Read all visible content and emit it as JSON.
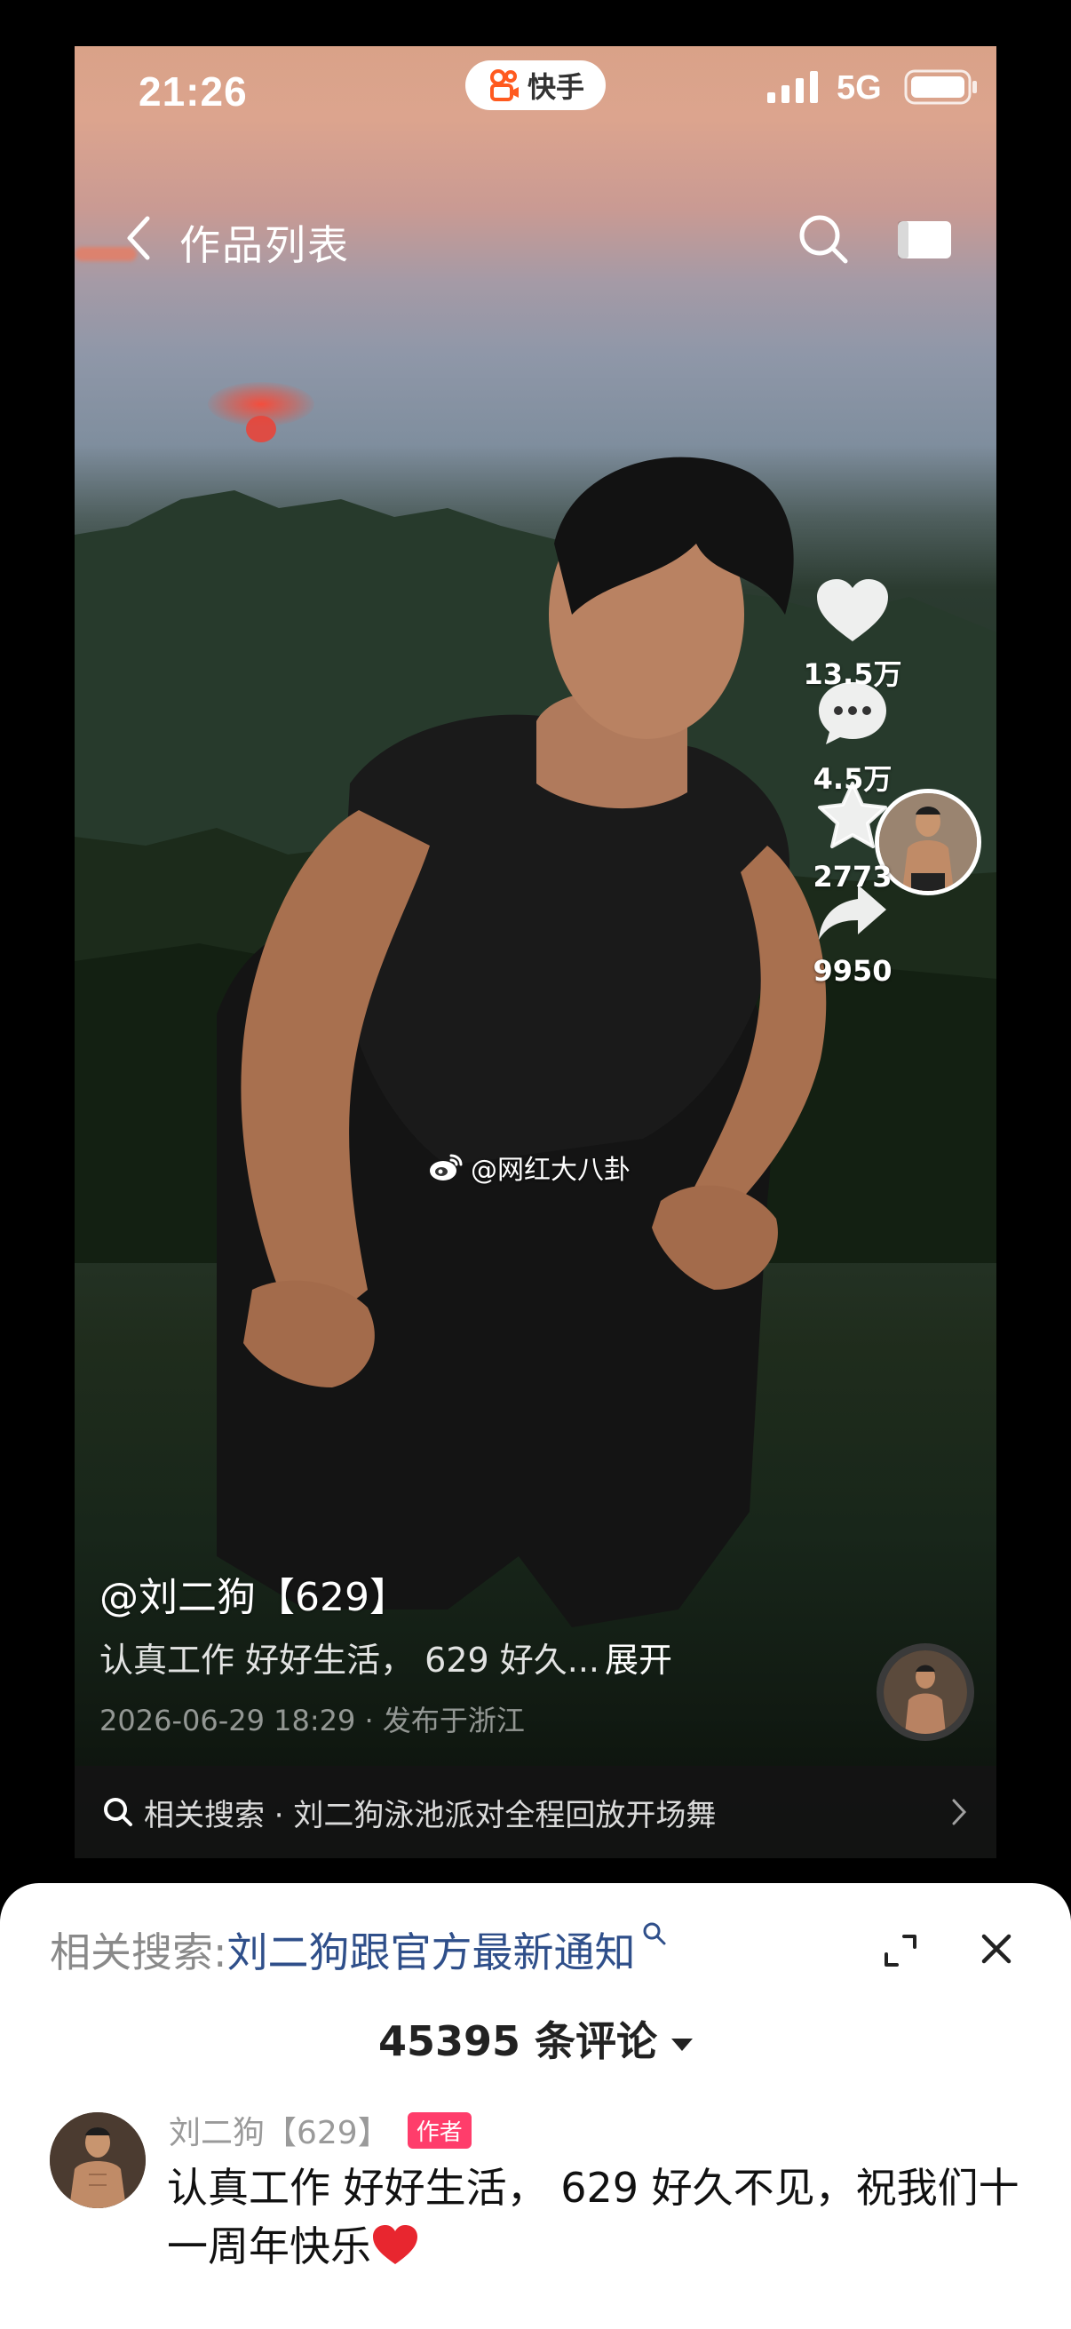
{
  "status_bar": {
    "time": "21:26",
    "app_name": "快手",
    "network": "5G"
  },
  "nav": {
    "title": "作品列表"
  },
  "rail": {
    "likes": "13.5万",
    "comments": "4.5万",
    "favorites": "2773",
    "shares": "9950"
  },
  "watermark": "@网红大八卦",
  "caption": {
    "author": "@刘二狗【629】",
    "description": "认真工作 好好生活， 629 好久...",
    "expand": "展开",
    "publish_info": "2026-06-29 18:29 · 发布于浙江"
  },
  "related_bar": {
    "text": "相关搜索 · 刘二狗泳池派对全程回放开场舞"
  },
  "sheet": {
    "search_label": "相关搜索:",
    "search_link": "刘二狗跟官方最新通知",
    "comment_count": "45395 条评论",
    "comment": {
      "name": "刘二狗【629】",
      "badge": "作者",
      "text": "认真工作 好好生活， 629 好久不见，祝我们十一周年快乐"
    }
  },
  "colors": {
    "link": "#2f4f8a",
    "author_badge": "#ff3d6b",
    "sky_top": "#d9a288",
    "sun": "#e8453a"
  },
  "icons": [
    "back-icon",
    "search-icon",
    "screen-icon",
    "heart-icon",
    "comment-icon",
    "star-icon",
    "share-icon",
    "expand-icon",
    "close-icon",
    "weibo-icon"
  ]
}
